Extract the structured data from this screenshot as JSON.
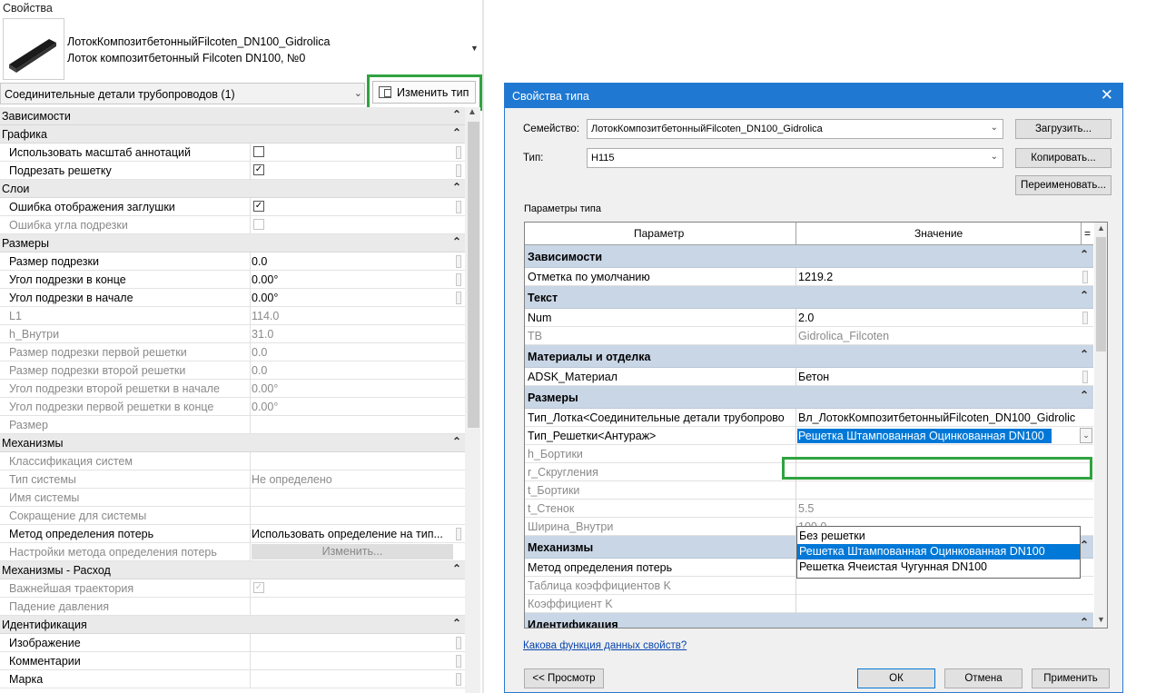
{
  "properties_panel": {
    "title": "Свойства",
    "family_name": "ЛотокКомпозитбетонныйFilcoten_DN100_Gidrolica",
    "family_type": "Лоток композитбетонный Filcoten DN100, №0",
    "selector": "Соединительные детали трубопроводов (1)",
    "edit_type_label": "Изменить тип",
    "rows": [
      {
        "kind": "group",
        "name": "Зависимости"
      },
      {
        "kind": "group",
        "name": "Графика"
      },
      {
        "kind": "row",
        "name": "Использовать масштаб аннотаций",
        "checkbox": false
      },
      {
        "kind": "row",
        "name": "Подрезать решетку",
        "checkbox": true
      },
      {
        "kind": "group",
        "name": "Слои"
      },
      {
        "kind": "row",
        "name": "Ошибка отображения заглушки",
        "checkbox": true
      },
      {
        "kind": "row",
        "name": "Ошибка угла подрезки",
        "checkbox": false,
        "dim": true
      },
      {
        "kind": "group",
        "name": "Размеры"
      },
      {
        "kind": "row",
        "name": "Размер подрезки",
        "value": "0.0"
      },
      {
        "kind": "row",
        "name": "Угол подрезки в конце",
        "value": "0.00°"
      },
      {
        "kind": "row",
        "name": "Угол подрезки в начале",
        "value": "0.00°"
      },
      {
        "kind": "row",
        "name": "L1",
        "value": "114.0",
        "dim": true
      },
      {
        "kind": "row",
        "name": "h_Внутри",
        "value": "31.0",
        "dim": true
      },
      {
        "kind": "row",
        "name": "Размер подрезки первой решетки",
        "value": "0.0",
        "dim": true
      },
      {
        "kind": "row",
        "name": "Размер подрезки второй решетки",
        "value": "0.0",
        "dim": true
      },
      {
        "kind": "row",
        "name": "Угол подрезки второй решетки в начале",
        "value": "0.00°",
        "dim": true
      },
      {
        "kind": "row",
        "name": "Угол подрезки первой решетки в конце",
        "value": "0.00°",
        "dim": true
      },
      {
        "kind": "row",
        "name": "Размер",
        "value": "",
        "dim": true
      },
      {
        "kind": "group",
        "name": "Механизмы"
      },
      {
        "kind": "row",
        "name": "Классификация систем",
        "value": "",
        "dim": true
      },
      {
        "kind": "row",
        "name": "Тип системы",
        "value": "Не определено",
        "dim": true
      },
      {
        "kind": "row",
        "name": "Имя системы",
        "value": "",
        "dim": true
      },
      {
        "kind": "row",
        "name": "Сокращение для системы",
        "value": "",
        "dim": true
      },
      {
        "kind": "row",
        "name": "Метод определения потерь",
        "value": "Использовать определение на тип..."
      },
      {
        "kind": "row",
        "name": "Настройки метода определения потерь",
        "button": "Изменить...",
        "dim": true
      },
      {
        "kind": "group",
        "name": "Механизмы - Расход"
      },
      {
        "kind": "row",
        "name": "Важнейшая траектория",
        "checkbox": true,
        "dim": true
      },
      {
        "kind": "row",
        "name": "Падение давления",
        "value": "",
        "dim": true
      },
      {
        "kind": "group",
        "name": "Идентификация"
      },
      {
        "kind": "row",
        "name": "Изображение",
        "value": ""
      },
      {
        "kind": "row",
        "name": "Комментарии",
        "value": ""
      },
      {
        "kind": "row",
        "name": "Марка",
        "value": ""
      }
    ]
  },
  "type_dialog": {
    "title": "Свойства типа",
    "family_label": "Семейство:",
    "family_value": "ЛотокКомпозитбетонныйFilcoten_DN100_Gidrolica",
    "type_label": "Тип:",
    "type_value": "H115",
    "load_button": "Загрузить...",
    "copy_button": "Копировать...",
    "rename_button": "Переименовать...",
    "params_caption": "Параметры типа",
    "col_param": "Параметр",
    "col_value": "Значение",
    "col_eq": "=",
    "rows": [
      {
        "kind": "group",
        "name": "Зависимости"
      },
      {
        "kind": "row",
        "name": "Отметка по умолчанию",
        "value": "1219.2",
        "handle": true
      },
      {
        "kind": "group",
        "name": "Текст"
      },
      {
        "kind": "row",
        "name": "Num",
        "value": "2.0",
        "handle": true
      },
      {
        "kind": "row",
        "name": "TB",
        "value": "Gidrolica_Filcoten",
        "dim": true
      },
      {
        "kind": "group",
        "name": "Материалы и отделка"
      },
      {
        "kind": "row",
        "name": "ADSK_Материал",
        "value": "Бетон",
        "handle": true
      },
      {
        "kind": "group",
        "name": "Размеры"
      },
      {
        "kind": "row",
        "name": "Тип_Лотка<Соединительные детали трубопрово",
        "value": "Вл_ЛотокКомпозитбетонныйFilcoten_DN100_Gidrolic"
      },
      {
        "kind": "select",
        "name": "Тип_Решетки<Антураж>",
        "value": "Решетка Штампованная Оцинкованная DN100"
      },
      {
        "kind": "row",
        "name": "h_Бортики",
        "value": "",
        "dim": true
      },
      {
        "kind": "row",
        "name": "r_Скругления",
        "value": "",
        "dim": true
      },
      {
        "kind": "row",
        "name": "t_Бортики",
        "value": "",
        "dim": true
      },
      {
        "kind": "row",
        "name": "t_Стенок",
        "value": "5.5",
        "dim": true
      },
      {
        "kind": "row",
        "name": "Ширина_Внутри",
        "value": "100.0",
        "dim": true
      },
      {
        "kind": "group",
        "name": "Механизмы"
      },
      {
        "kind": "row",
        "name": "Метод определения потерь",
        "value": ""
      },
      {
        "kind": "row",
        "name": "Таблица коэффициентов K",
        "value": "",
        "dim": true
      },
      {
        "kind": "row",
        "name": "Коэффициент K",
        "value": "",
        "dim": true
      },
      {
        "kind": "group",
        "name": "Идентификация"
      }
    ],
    "dropdown_options": [
      {
        "label": "Без решетки",
        "selected": false
      },
      {
        "label": "Решетка Штампованная Оцинкованная DN100",
        "selected": true
      },
      {
        "label": "Решетка Ячеистая Чугунная DN100",
        "selected": false
      }
    ],
    "help_link": "Какова функция данных свойств?",
    "preview_button": "<< Просмотр",
    "ok_button": "ОК",
    "cancel_button": "Отмена",
    "apply_button": "Применить"
  }
}
